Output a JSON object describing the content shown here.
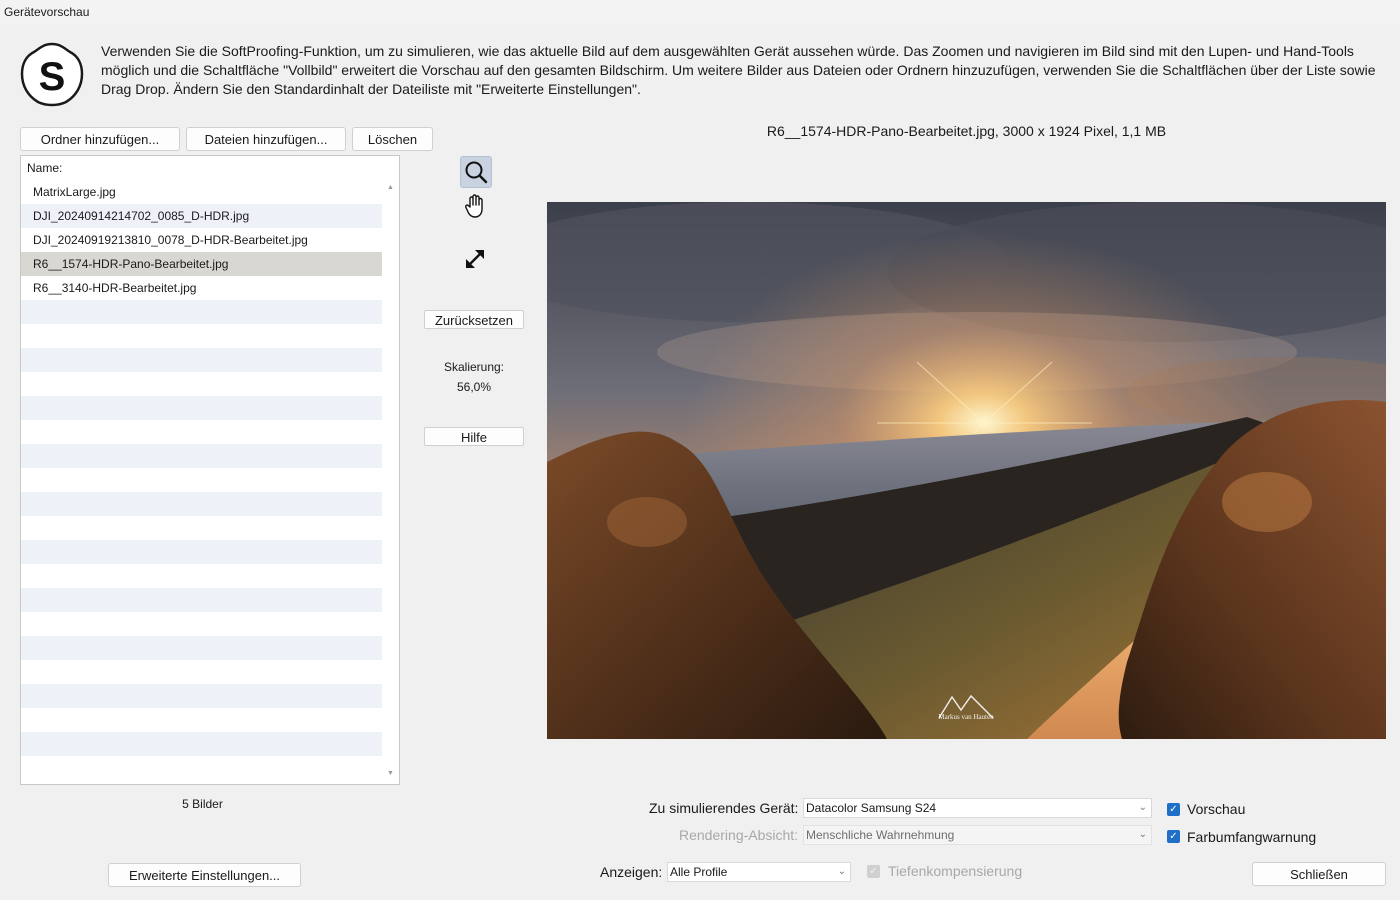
{
  "window": {
    "title": "Gerätevorschau"
  },
  "logo": {
    "letter": "S"
  },
  "intro": {
    "text": "Verwenden Sie die SoftProofing-Funktion, um zu simulieren, wie das aktuelle Bild auf dem ausgewählten Gerät aussehen würde. Das Zoomen und navigieren im Bild sind mit den Lupen- und Hand-Tools möglich und die Schaltfläche \"Vollbild\" erweitert die Vorschau auf den gesamten Bildschirm. Um weitere Bilder aus Dateien oder Ordnern hinzuzufügen, verwenden Sie die Schaltflächen über der Liste sowie Drag  Drop. Ändern Sie den Standardinhalt der Dateiliste mit \"Erweiterte Einstellungen\"."
  },
  "buttons": {
    "add_folder": "Ordner hinzufügen...",
    "add_files": "Dateien hinzufügen...",
    "delete": "Löschen",
    "reset": "Zurücksetzen",
    "help": "Hilfe",
    "advanced": "Erweiterte Einstellungen...",
    "close": "Schließen"
  },
  "filelist": {
    "header": "Name:",
    "files": [
      "MatrixLarge.jpg",
      "DJI_20240914214702_0085_D-HDR.jpg",
      "DJI_20240919213810_0078_D-HDR-Bearbeitet.jpg",
      "R6__1574-HDR-Pano-Bearbeitet.jpg",
      "R6__3140-HDR-Bearbeitet.jpg"
    ],
    "selected_index": 3,
    "count_label": "5 Bilder"
  },
  "tools": {
    "zoom_icon": "magnifier-icon",
    "pan_icon": "hand-icon",
    "fullscreen_icon": "expand-icon"
  },
  "scale": {
    "label": "Skalierung:",
    "value": "56,0%"
  },
  "image": {
    "caption": "R6__1574-HDR-Pano-Bearbeitet.jpg, 3000 x 1924 Pixel, 1,1 MB",
    "watermark": "Markus van Hauten"
  },
  "settings": {
    "device_label": "Zu simulierendes Gerät:",
    "device_value": "Datacolor Samsung S24",
    "intent_label": "Rendering-Absicht:",
    "intent_value": "Menschliche Wahrnehmung",
    "show_label": "Anzeigen:",
    "show_value": "Alle Profile",
    "preview_label": "Vorschau",
    "preview_checked": true,
    "gamut_label": "Farbumfangwarnung",
    "gamut_checked": true,
    "depth_label": "Tiefenkompensierung",
    "depth_checked": true
  },
  "colors": {
    "check_blue": "#1f6fc8",
    "selected_row": "#d9d7d2",
    "alt_row": "#eef2f8",
    "active_tool": "#c9d2e0"
  }
}
